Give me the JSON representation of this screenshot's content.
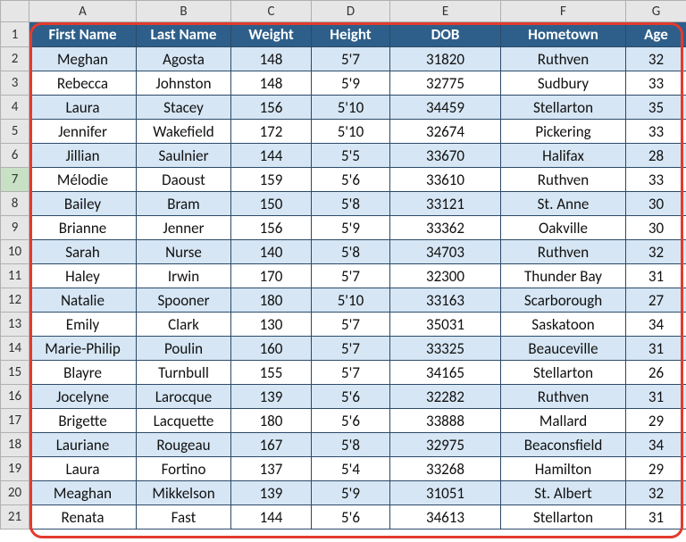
{
  "columns": [
    "A",
    "B",
    "C",
    "D",
    "E",
    "F",
    "G"
  ],
  "row_numbers": [
    1,
    2,
    3,
    4,
    5,
    6,
    7,
    8,
    9,
    10,
    11,
    12,
    13,
    14,
    15,
    16,
    17,
    18,
    19,
    20,
    21
  ],
  "selected_row_header": 7,
  "headers": [
    "First Name",
    "Last Name",
    "Weight",
    "Height",
    "DOB",
    "Hometown",
    "Age"
  ],
  "chart_data": {
    "type": "table",
    "columns": [
      "First Name",
      "Last Name",
      "Weight",
      "Height",
      "DOB",
      "Hometown",
      "Age"
    ],
    "rows": [
      [
        "Meghan",
        "Agosta",
        148,
        "5'7",
        31820,
        "Ruthven",
        32
      ],
      [
        "Rebecca",
        "Johnston",
        148,
        "5'9",
        32775,
        "Sudbury",
        33
      ],
      [
        "Laura",
        "Stacey",
        156,
        "5'10",
        34459,
        "Stellarton",
        35
      ],
      [
        "Jennifer",
        "Wakefield",
        172,
        "5'10",
        32674,
        "Pickering",
        33
      ],
      [
        "Jillian",
        "Saulnier",
        144,
        "5'5",
        33670,
        "Halifax",
        28
      ],
      [
        "Mélodie",
        "Daoust",
        159,
        "5'6",
        33610,
        "Ruthven",
        33
      ],
      [
        "Bailey",
        "Bram",
        150,
        "5'8",
        33121,
        "St. Anne",
        30
      ],
      [
        "Brianne",
        "Jenner",
        156,
        "5'9",
        33362,
        "Oakville",
        30
      ],
      [
        "Sarah",
        "Nurse",
        140,
        "5'8",
        34703,
        "Ruthven",
        32
      ],
      [
        "Haley",
        "Irwin",
        170,
        "5'7",
        32300,
        "Thunder Bay",
        31
      ],
      [
        "Natalie",
        "Spooner",
        180,
        "5'10",
        33163,
        "Scarborough",
        27
      ],
      [
        "Emily",
        "Clark",
        130,
        "5'7",
        35031,
        "Saskatoon",
        34
      ],
      [
        "Marie-Philip",
        "Poulin",
        160,
        "5'7",
        33325,
        "Beauceville",
        31
      ],
      [
        "Blayre",
        "Turnbull",
        155,
        "5'7",
        34165,
        "Stellarton",
        26
      ],
      [
        "Jocelyne",
        "Larocque",
        139,
        "5'6",
        32282,
        "Ruthven",
        31
      ],
      [
        "Brigette",
        "Lacquette",
        180,
        "5'6",
        33888,
        "Mallard",
        29
      ],
      [
        "Lauriane",
        "Rougeau",
        167,
        "5'8",
        32975,
        "Beaconsfield",
        34
      ],
      [
        "Laura",
        "Fortino",
        137,
        "5'4",
        33268,
        "Hamilton",
        29
      ],
      [
        "Meaghan",
        "Mikkelson",
        139,
        "5'9",
        31051,
        "St. Albert",
        32
      ],
      [
        "Renata",
        "Fast",
        144,
        "5'6",
        34613,
        "Stellarton",
        31
      ]
    ]
  }
}
